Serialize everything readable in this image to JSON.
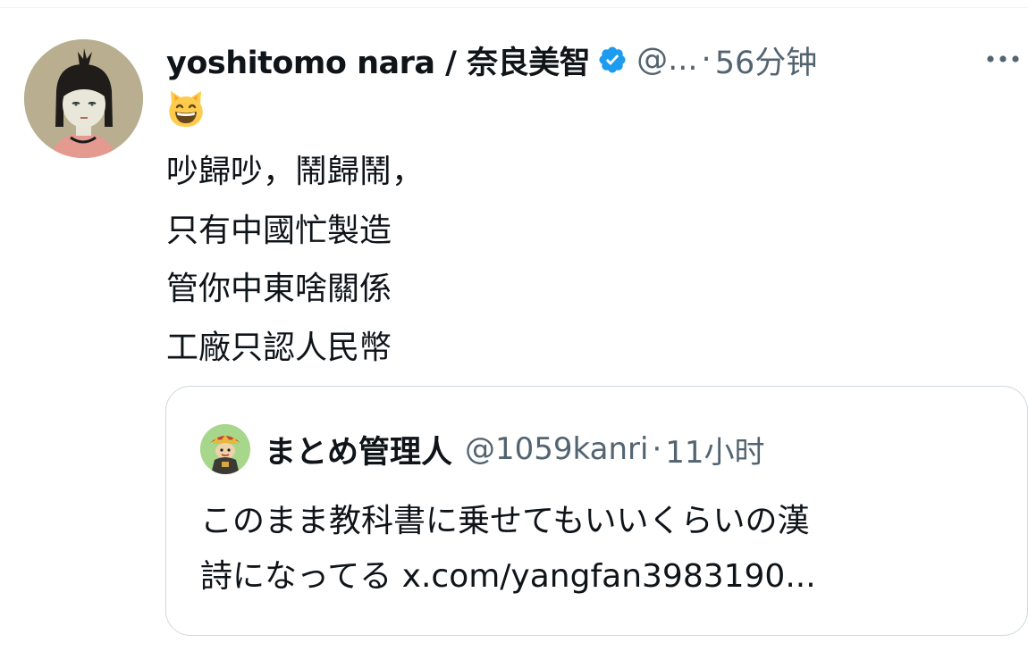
{
  "tweet": {
    "author": {
      "display_name": "yoshitomo nara / 奈良美智",
      "verified": true,
      "handle": "@...",
      "avatar_icon": "avatar-girl-illustration"
    },
    "separator": "·",
    "timestamp": "56分钟",
    "more_icon": "more-horizontal-icon",
    "emoji": "grinning-cat-emoji",
    "text_lines": [
      "吵歸吵，鬧歸鬧，",
      "只有中國忙製造",
      "管你中東啥關係",
      "工廠只認人民幣"
    ]
  },
  "quote": {
    "author": {
      "display_name": "まとめ管理人",
      "handle": "@1059kanri",
      "avatar_icon": "avatar-mascot"
    },
    "separator": "·",
    "timestamp": "11小时",
    "text_line1": "このまま教科書に乗せてもいいくらいの漢",
    "text_line2_prefix": "詩になってる ",
    "link": "x.com/yangfan3983190..."
  },
  "colors": {
    "text_primary": "#0f1419",
    "text_secondary": "#536471",
    "verified_blue": "#1d9bf0",
    "border": "#cfd9de"
  }
}
